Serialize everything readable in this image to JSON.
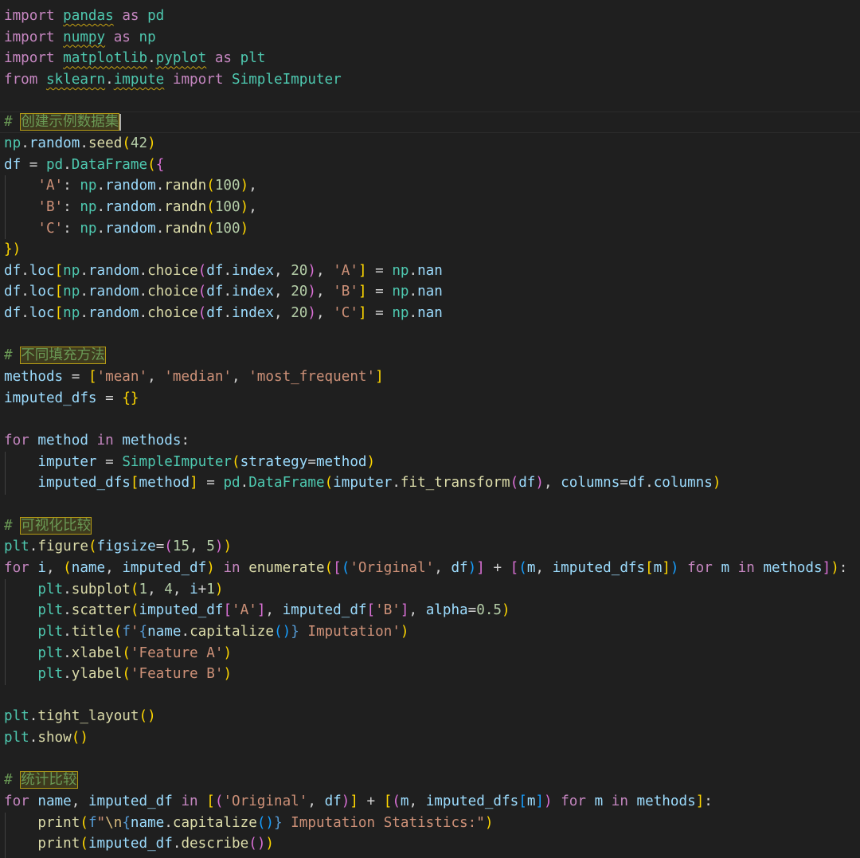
{
  "editor": {
    "theme_colors": {
      "background": "#1f1f1f",
      "keyword": "#c586c0",
      "module": "#4ec9b0",
      "variable": "#9cdcfe",
      "function": "#dcdcaa",
      "string": "#ce9178",
      "number": "#b5cea8",
      "comment": "#6a9955",
      "bracket_level1": "#ffd700",
      "bracket_level2": "#da70d6",
      "bracket_level3": "#179fff",
      "warning_underline": "#c7a412"
    },
    "lines": [
      "import pandas as pd",
      "import numpy as np",
      "import matplotlib.pyplot as plt",
      "from sklearn.impute import SimpleImputer",
      "",
      "# 创建示例数据集",
      "np.random.seed(42)",
      "df = pd.DataFrame({",
      "    'A': np.random.randn(100),",
      "    'B': np.random.randn(100),",
      "    'C': np.random.randn(100)",
      "})",
      "df.loc[np.random.choice(df.index, 20), 'A'] = np.nan",
      "df.loc[np.random.choice(df.index, 20), 'B'] = np.nan",
      "df.loc[np.random.choice(df.index, 20), 'C'] = np.nan",
      "",
      "# 不同填充方法",
      "methods = ['mean', 'median', 'most_frequent']",
      "imputed_dfs = {}",
      "",
      "for method in methods:",
      "    imputer = SimpleImputer(strategy=method)",
      "    imputed_dfs[method] = pd.DataFrame(imputer.fit_transform(df), columns=df.columns)",
      "",
      "# 可视化比较",
      "plt.figure(figsize=(15, 5))",
      "for i, (name, imputed_df) in enumerate([('Original', df)] + [(m, imputed_dfs[m]) for m in methods]):",
      "    plt.subplot(1, 4, i+1)",
      "    plt.scatter(imputed_df['A'], imputed_df['B'], alpha=0.5)",
      "    plt.title(f'{name.capitalize()} Imputation')",
      "    plt.xlabel('Feature A')",
      "    plt.ylabel('Feature B')",
      "",
      "plt.tight_layout()",
      "plt.show()",
      "",
      "# 统计比较",
      "for name, imputed_df in [('Original', df)] + [(m, imputed_dfs[m]) for m in methods]:",
      "    print(f\"\\n{name.capitalize()} Imputation Statistics:\")",
      "    print(imputed_df.describe())"
    ]
  }
}
